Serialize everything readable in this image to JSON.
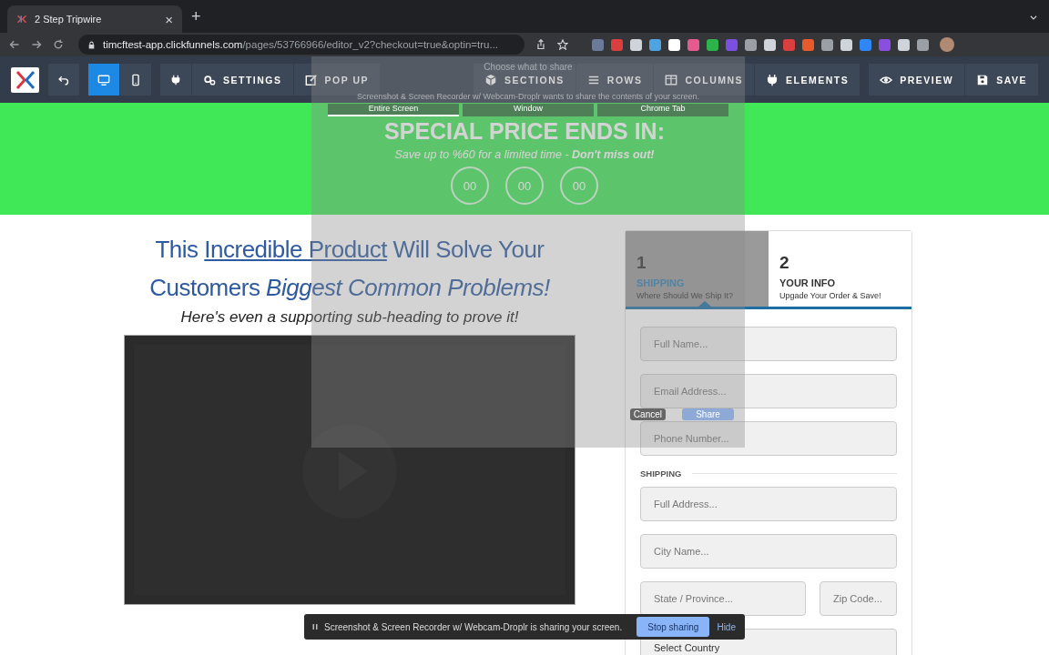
{
  "browser": {
    "tab_title": "2 Step Tripwire",
    "tab_close": "×",
    "new_tab": "+",
    "url_domain": "timcftest-app.clickfunnels.com",
    "url_path": "/pages/53766966/editor_v2?checkout=true&optin=tru..."
  },
  "toolbar": {
    "devices": [
      {
        "selected": true
      },
      {
        "selected": false
      }
    ],
    "left_buttons": [
      "SETTINGS",
      "POP UP"
    ],
    "structure_buttons": [
      "SECTIONS",
      "ROWS",
      "COLUMNS",
      "ELEMENTS"
    ],
    "action_buttons": [
      "PREVIEW",
      "SAVE"
    ]
  },
  "banner": {
    "title": "SPECIAL PRICE ENDS IN:",
    "subtitle": "Save up to %60 for a limited time - **Don't miss out!**",
    "timer": [
      "00",
      "00",
      "00"
    ]
  },
  "headline": {
    "before": "This ",
    "link": "Incredible Product",
    "after": " Will Solve Your Customers *Biggest Common Problems!*"
  },
  "subheading": "Here's even a supporting sub-heading to prove it!",
  "form": {
    "steps": [
      {
        "number": "1",
        "title": "SHIPPING",
        "subtitle": "Where Should We Ship It?",
        "selected": true
      },
      {
        "number": "2",
        "title": "YOUR INFO",
        "subtitle": "Upgade Your Order & Save!",
        "selected": false
      }
    ],
    "contact_fields": [
      {
        "placeholder": "Full Name..."
      },
      {
        "placeholder": "Email Address..."
      },
      {
        "placeholder": "Phone Number..."
      }
    ],
    "section_label": "SHIPPING",
    "address_rows": [
      [
        {
          "placeholder": "Full Address...",
          "kind": "input"
        }
      ],
      [
        {
          "placeholder": "City Name...",
          "kind": "input"
        }
      ],
      [
        {
          "placeholder": "State / Province...",
          "kind": "input"
        },
        {
          "placeholder": "Zip Code...",
          "kind": "input"
        }
      ],
      [
        {
          "placeholder": "Select Country",
          "kind": "select"
        }
      ]
    ]
  },
  "share_dialog": {
    "title": "Choose what to share",
    "message": "Screenshot & Screen Recorder w/ Webcam-Droplr wants to share the contents of your screen.",
    "tabs": [
      {
        "label": "Entire Screen",
        "selected": true
      },
      {
        "label": "Window",
        "selected": false
      },
      {
        "label": "Chrome Tab",
        "selected": false
      }
    ],
    "cancel": "Cancel",
    "share": "Share"
  },
  "sharing_bar": {
    "message": "Screenshot & Screen Recorder w/ Webcam-Droplr is sharing your screen.",
    "stop": "Stop sharing",
    "hide": "Hide"
  }
}
